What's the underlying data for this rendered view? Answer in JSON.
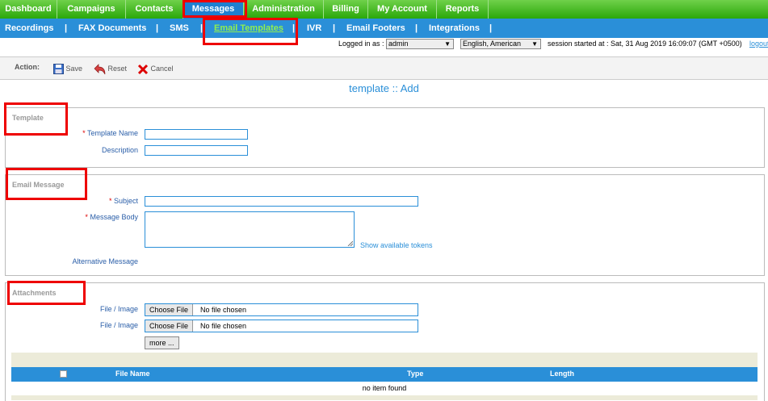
{
  "topnav": {
    "items": [
      "Dashboard",
      "Campaigns",
      "Contacts",
      "Messages",
      "Administration",
      "Billing",
      "My Account",
      "Reports"
    ],
    "active": "Messages"
  },
  "subnav": {
    "items": [
      "Recordings",
      "FAX Documents",
      "SMS",
      "Email Templates",
      "IVR",
      "Email Footers",
      "Integrations"
    ],
    "active": "Email Templates",
    "separator": "|"
  },
  "session": {
    "logged_in_label": "Logged in as :",
    "user": "admin",
    "language": "English, American",
    "started": "session started at : Sat, 31 Aug 2019 16:09:07 (GMT +0500)",
    "logout": "logout"
  },
  "toolbar": {
    "label": "Action:",
    "save": "Save",
    "reset": "Reset",
    "cancel": "Cancel"
  },
  "page_title": "template :: Add",
  "template_section": {
    "legend": "Template",
    "name_label": "Template Name",
    "desc_label": "Description",
    "required_mark": "*"
  },
  "email_section": {
    "legend": "Email Message",
    "subject_label": "Subject",
    "body_label": "Message Body",
    "tokens_link": "Show available tokens",
    "alt_label": "Alternative Message"
  },
  "attach_section": {
    "legend": "Attachments",
    "file_label": "File / Image",
    "choose": "Choose File",
    "no_file": "No file chosen",
    "more": "more ...",
    "columns": [
      "File Name",
      "Type",
      "Length"
    ],
    "empty": "no item found"
  },
  "colors": {
    "green": "#2aa70a",
    "blue": "#2a8fd8",
    "highlight": "#e00000"
  }
}
